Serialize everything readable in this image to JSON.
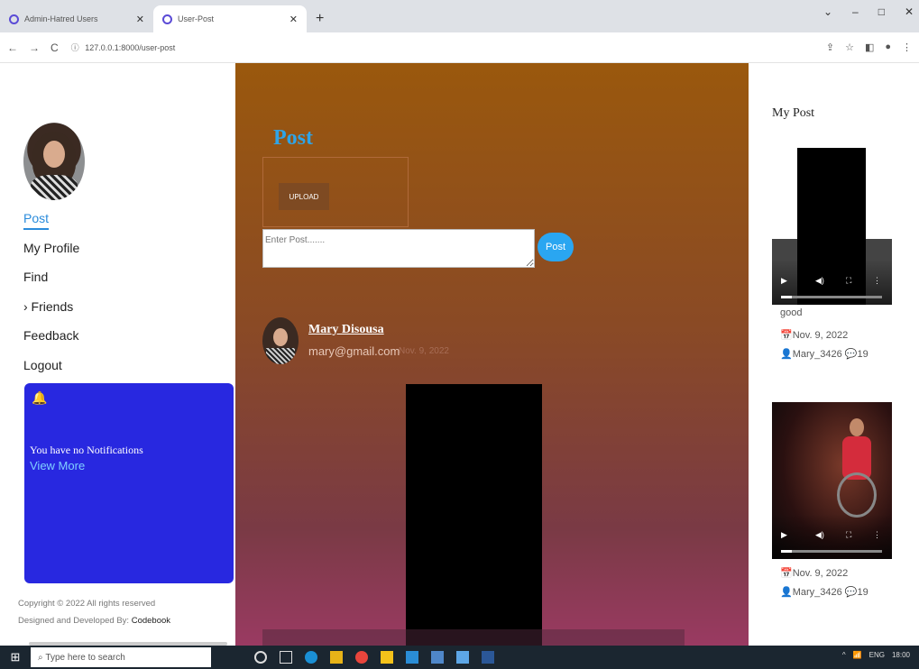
{
  "browser": {
    "tabs": [
      {
        "label": "Admin-Hatred Users",
        "active": false
      },
      {
        "label": "User-Post",
        "active": true
      }
    ],
    "url": "127.0.0.1:8000/user-post",
    "icons": [
      "back-icon",
      "forward-icon",
      "reload-icon"
    ]
  },
  "sidebar": {
    "menu": [
      {
        "label": "Post",
        "active": true
      },
      {
        "label": "My Profile",
        "active": false
      },
      {
        "label": "Find",
        "active": false
      },
      {
        "label": "› Friends",
        "active": false
      },
      {
        "label": "Feedback",
        "active": false
      },
      {
        "label": "Logout",
        "active": false
      }
    ],
    "notifications": {
      "message": "You have no Notifications",
      "more": "View More"
    },
    "footer": {
      "copyright": "Copyright © 2022 All rights reserved",
      "designed_prefix": "Designed and Developed By:",
      "designed_by": "Codebook"
    }
  },
  "main": {
    "title": "Post",
    "upload_label": "UPLOAD",
    "input_placeholder": "Enter Post.......",
    "post_button": "Post",
    "post": {
      "user": "Mary Disousa",
      "email": "mary@gmail.com",
      "date": "Nov. 9, 2022"
    }
  },
  "right": {
    "title": "My Post",
    "posts": [
      {
        "caption": "good",
        "date": "Nov. 9, 2022",
        "user": "Mary_3426",
        "count": "19"
      },
      {
        "caption": "",
        "date": "Nov. 9, 2022",
        "user": "Mary_3426",
        "count": "19"
      }
    ]
  },
  "taskbar": {
    "search_placeholder": "Type here to search",
    "lang": "ENG",
    "time": "18:00"
  },
  "colors": {
    "accent": "#2aa6f1",
    "notification_bg": "#2828e0",
    "gradient_top": "#9a580d",
    "gradient_bottom": "#9a3a62"
  }
}
